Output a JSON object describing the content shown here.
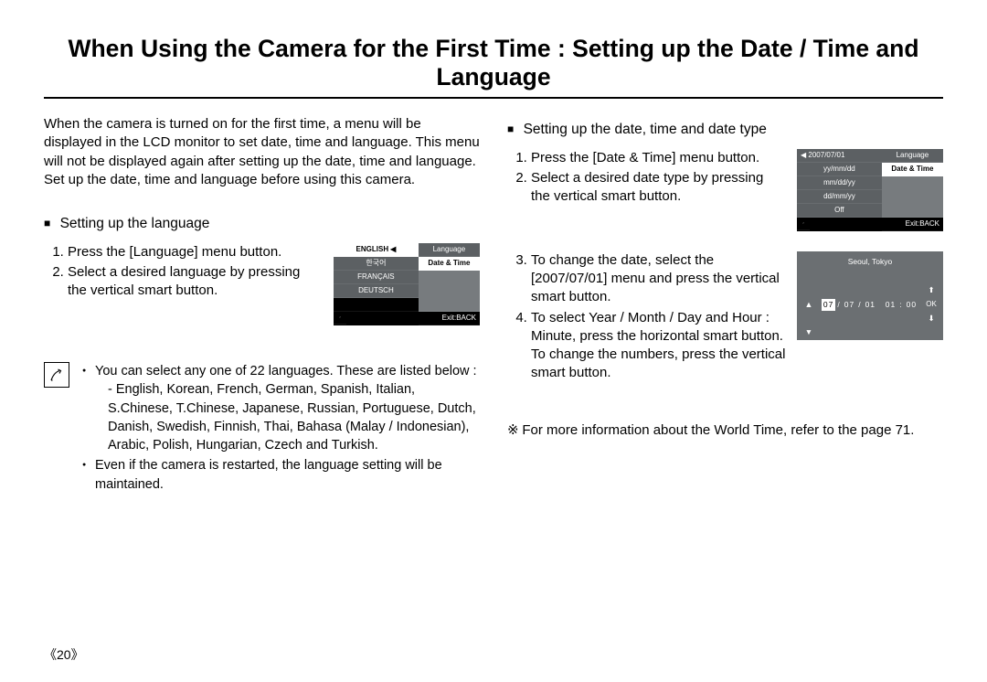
{
  "title": "When Using the Camera for the First Time : Setting up the Date / Time and Language",
  "intro": "When the camera is turned on for the first time, a menu will be displayed in the LCD monitor to set date, time and language. This menu will not be displayed again after setting up the date, time and language. Set up the date, time and language before using this camera.",
  "left": {
    "subhead": "Setting up the language",
    "steps": [
      "Press the [Language] menu button.",
      "Select a desired language by pressing the vertical smart button."
    ],
    "screen": {
      "left_items": [
        "ENGLISH",
        "한국어",
        "FRANÇAIS",
        "DEUTSCH",
        ""
      ],
      "right_items": [
        "Language",
        "Date & Time"
      ],
      "exit": "Exit:BACK"
    }
  },
  "note": {
    "bullets": [
      "You can select any one of 22 languages. These are listed below :",
      "Even if the camera is restarted, the language setting will be maintained."
    ],
    "languages": "- English, Korean, French, German, Spanish, Italian, S.Chinese, T.Chinese, Japanese, Russian, Portuguese, Dutch, Danish, Swedish, Finnish, Thai, Bahasa (Malay / Indonesian), Arabic, Polish, Hungarian, Czech and Turkish."
  },
  "right": {
    "subhead": "Setting up the date, time and date type",
    "steps12": [
      "Press the [Date & Time] menu button.",
      "Select a desired date type by pressing the vertical smart button."
    ],
    "screen1": {
      "left_items": [
        "2007/07/01",
        "yy/mm/dd",
        "mm/dd/yy",
        "dd/mm/yy",
        "Off"
      ],
      "right_items": [
        "Language",
        "Date & Time"
      ],
      "exit": "Exit:BACK"
    },
    "steps34": [
      "To change the date, select the [2007/07/01] menu and press the vertical smart button.",
      "To select Year / Month / Day and Hour : Minute, press the horizontal smart button. To change the numbers, press the vertical smart button."
    ],
    "screen2": {
      "tz": "Seoul, Tokyo",
      "date": {
        "yy": "07",
        "sep1": " / ",
        "mm": "07",
        "sep2": " / ",
        "dd": "01",
        "hh": "01",
        "tsep": " : ",
        "min": "00"
      },
      "ok": "OK"
    },
    "footnote": "For more information about the World Time, refer to the page 71."
  },
  "page": "20"
}
